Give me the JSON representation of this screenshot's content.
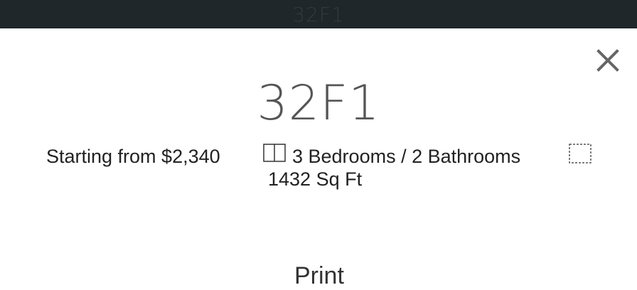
{
  "header": {
    "title": "32F1"
  },
  "modal": {
    "close_icon": "close-icon",
    "title": "32F1",
    "price_text": "Starting from $2,340",
    "bedrooms_text": "3 Bedrooms / 2 Bathrooms",
    "area_text": "1432 Sq Ft",
    "bed_icon": "floorplan-icon",
    "area_icon": "area-icon",
    "partial_heading": "Print"
  },
  "colors": {
    "topbar": "#1f272b",
    "title": "#555555",
    "text": "#222222"
  }
}
